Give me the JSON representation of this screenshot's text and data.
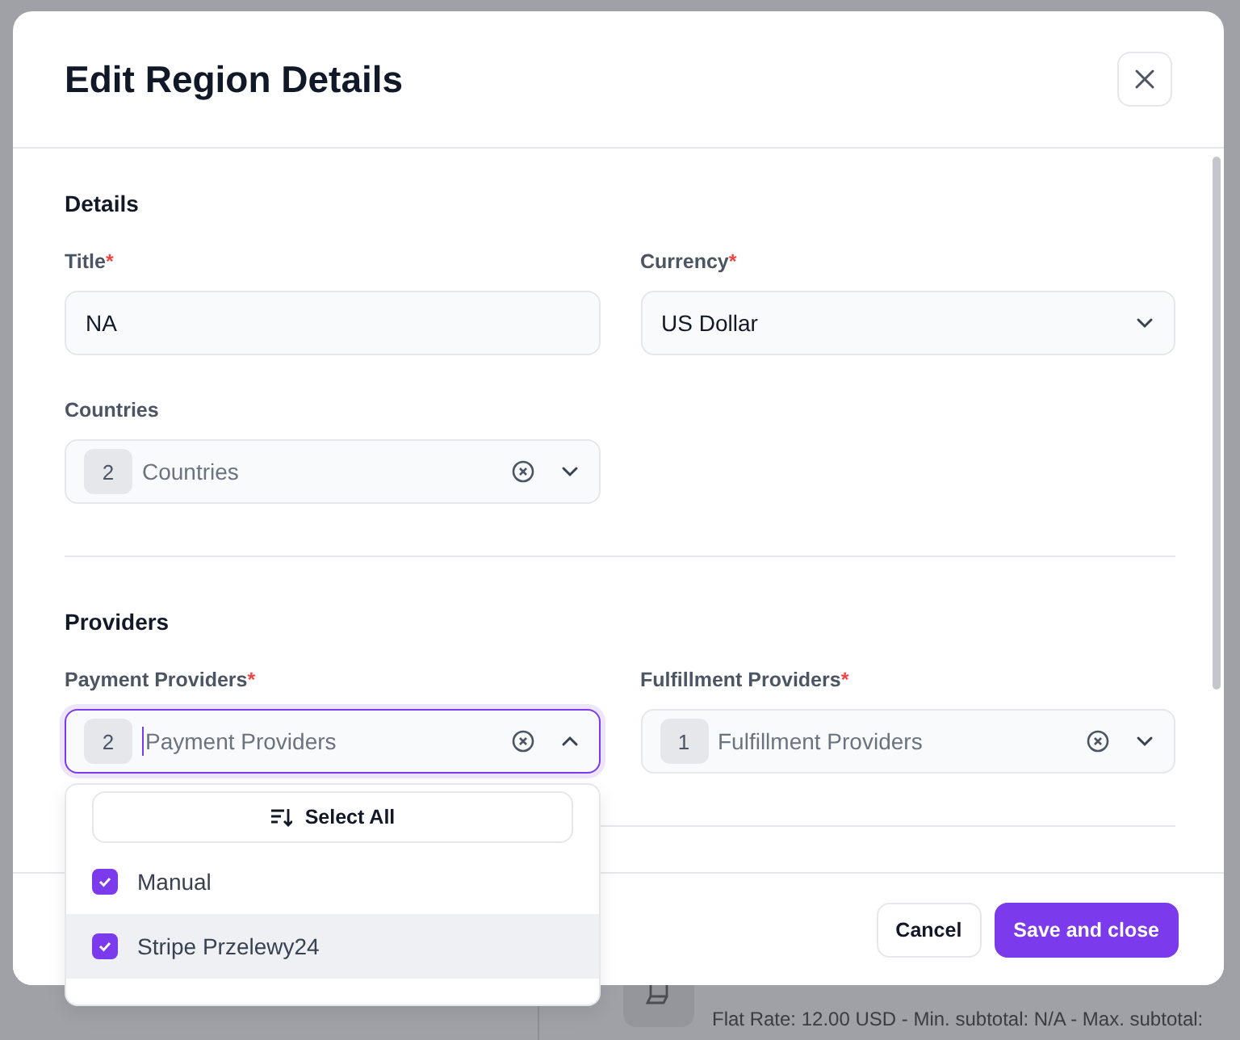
{
  "background": {
    "detail": "Flat Rate: 12.00 USD - Min. subtotal: N/A - Max. subtotal:"
  },
  "dialog": {
    "title": "Edit Region Details"
  },
  "sections": [
    {
      "heading": "Details",
      "fields": [
        {
          "label": "Title",
          "required_mark": "*",
          "kind": "text",
          "value": "NA"
        },
        {
          "label": "Currency",
          "required_mark": "*",
          "kind": "select",
          "value": "US Dollar"
        },
        {
          "label": "Countries",
          "kind": "multi",
          "count": "2",
          "placeholder": "Countries",
          "open": false
        }
      ]
    },
    {
      "heading": "Providers",
      "fields": [
        {
          "label": "Payment Providers",
          "required_mark": "*",
          "kind": "multi",
          "count": "2",
          "placeholder": "Payment Providers",
          "open": true
        },
        {
          "label": "Fulfillment Providers",
          "required_mark": "*",
          "kind": "multi",
          "count": "1",
          "placeholder": "Fulfillment Providers",
          "open": false
        }
      ]
    }
  ],
  "dropdown": {
    "select_all": "Select All",
    "options": [
      {
        "label": "Manual",
        "checked": true,
        "highlighted": false
      },
      {
        "label": "Stripe Przelewy24",
        "checked": true,
        "highlighted": true
      }
    ]
  },
  "buttons": [
    {
      "label": "Cancel",
      "kind": "secondary"
    },
    {
      "label": "Save and close",
      "kind": "primary"
    }
  ]
}
